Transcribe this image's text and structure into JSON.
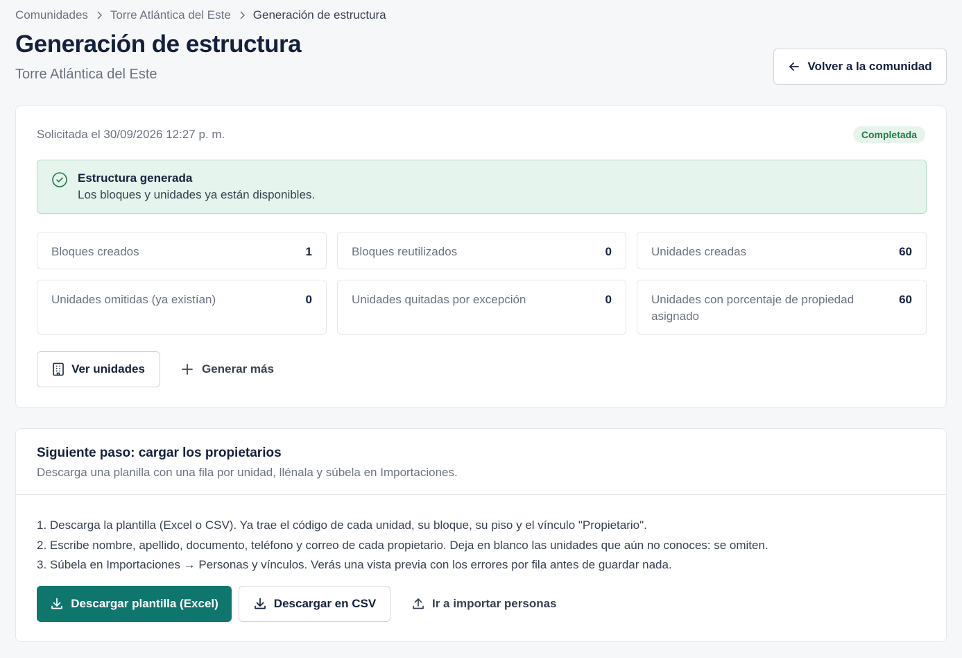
{
  "breadcrumb": {
    "items": [
      "Comunidades",
      "Torre Atlántica del Este",
      "Generación de estructura"
    ]
  },
  "header": {
    "title": "Generación de estructura",
    "subtitle": "Torre Atlántica del Este",
    "back_label": "Volver a la comunidad"
  },
  "summary": {
    "requested": "Solicitada el 30/09/2026 12:27 p. m.",
    "status": "Completada",
    "alert_title": "Estructura generada",
    "alert_desc": "Los bloques y unidades ya están disponibles.",
    "stats": [
      {
        "label": "Bloques creados",
        "value": "1"
      },
      {
        "label": "Bloques reutilizados",
        "value": "0"
      },
      {
        "label": "Unidades creadas",
        "value": "60"
      },
      {
        "label": "Unidades omitidas (ya existían)",
        "value": "0"
      },
      {
        "label": "Unidades quitadas por excepción",
        "value": "0"
      },
      {
        "label": "Unidades con porcentaje de propiedad asignado",
        "value": "60"
      }
    ],
    "view_units_label": "Ver unidades",
    "generate_more_label": "Generar más"
  },
  "next_step": {
    "title": "Siguiente paso: cargar los propietarios",
    "desc": "Descarga una planilla con una fila por unidad, llénala y súbela en Importaciones.",
    "steps": [
      "1. Descarga la plantilla (Excel o CSV). Ya trae el código de cada unidad, su bloque, su piso y el vínculo \"Propietario\".",
      "2. Escribe nombre, apellido, documento, teléfono y correo de cada propietario. Deja en blanco las unidades que aún no conoces: se omiten.",
      "3. Súbela en Importaciones → Personas y vínculos. Verás una vista previa con los errores por fila antes de guardar nada."
    ],
    "download_excel_label": "Descargar plantilla (Excel)",
    "download_csv_label": "Descargar en CSV",
    "import_label": "Ir a importar personas"
  },
  "colors": {
    "primary": "#0f766e",
    "success_bg": "#e5f4ec",
    "badge_text": "#1e7b45",
    "heading": "#14213d"
  }
}
